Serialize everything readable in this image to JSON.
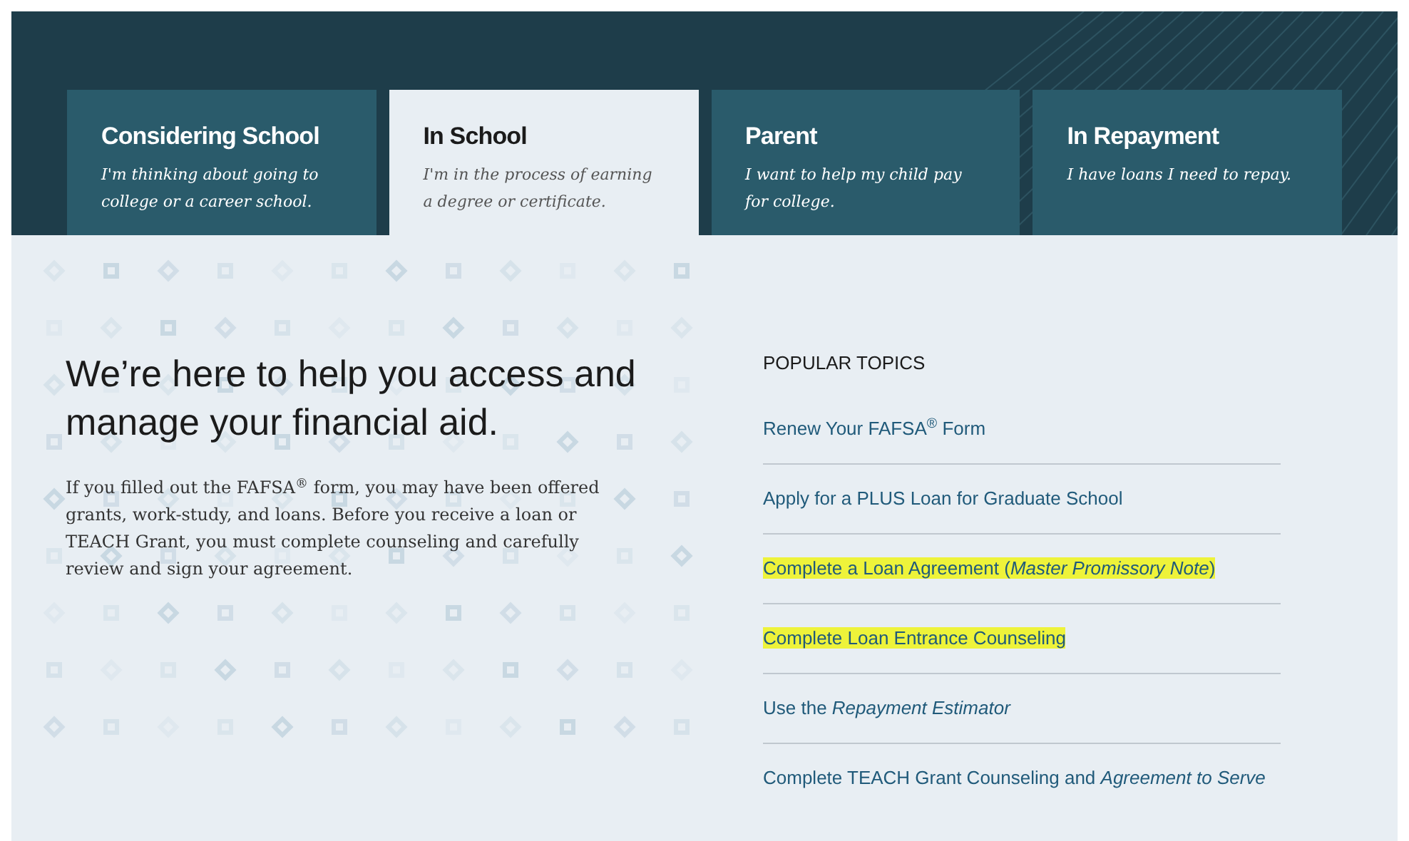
{
  "tabs": [
    {
      "title": "Considering School",
      "subtitle": "I'm thinking about going to college or a career school.",
      "selected": false
    },
    {
      "title": "In School",
      "subtitle": "I'm in the process of earning a degree or certificate.",
      "selected": true
    },
    {
      "title": "Parent",
      "subtitle": "I want to help my child pay for college.",
      "selected": false
    },
    {
      "title": "In Repayment",
      "subtitle": "I have loans I need to repay.",
      "selected": false
    }
  ],
  "intro": {
    "heading": "We’re here to help you access and manage your financial aid.",
    "body": "If you filled out the FAFSA$^{®}$ form, you may have been offered grants, work-study, and loans. Before you receive a loan or TEACH Grant, you must complete counseling and carefully review and sign your agreement."
  },
  "popular_topics": {
    "heading": "POPULAR TOPICS",
    "links": [
      {
        "text": "Renew Your FAFSA$^{®}$ Form",
        "highlighted": false
      },
      {
        "text": "Apply for a PLUS Loan for Graduate School",
        "highlighted": false
      },
      {
        "text": "Complete a Loan Agreement (*Master Promissory Note*)",
        "highlighted": true
      },
      {
        "text": "Complete Loan Entrance Counseling",
        "highlighted": true
      },
      {
        "text": "Use the *Repayment Estimator*",
        "highlighted": false
      },
      {
        "text": "Complete TEACH Grant Counseling and *Agreement to Serve*",
        "highlighted": false
      }
    ]
  }
}
